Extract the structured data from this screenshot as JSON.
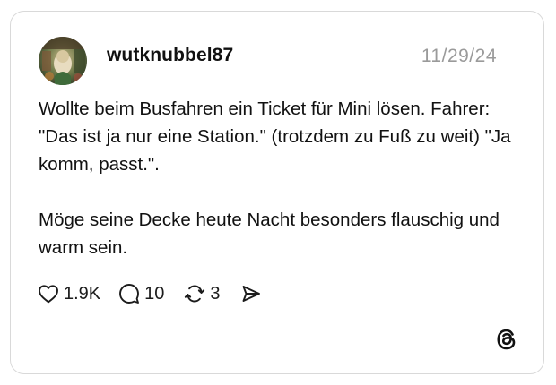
{
  "post": {
    "username": "wutknubbel87",
    "date": "11/29/24",
    "paragraphs": [
      "Wollte beim Busfahren ein Ticket für Mini lösen. Fahrer: \"Das ist ja nur eine Station.\" (trotzdem zu Fuß zu weit) \"Ja komm, passt.\".",
      "Möge seine Decke heute Nacht besonders flauschig und warm sein."
    ]
  },
  "actions": {
    "likes": "1.9K",
    "comments": "10",
    "reposts": "3"
  },
  "icons": {
    "like": "heart-icon",
    "comment": "speech-bubble-icon",
    "repost": "repost-arrows-icon",
    "share": "send-icon",
    "brand": "threads-logo-icon"
  },
  "colors": {
    "text": "#111111",
    "date": "#9a9a9a",
    "border": "#d9d9d9"
  }
}
